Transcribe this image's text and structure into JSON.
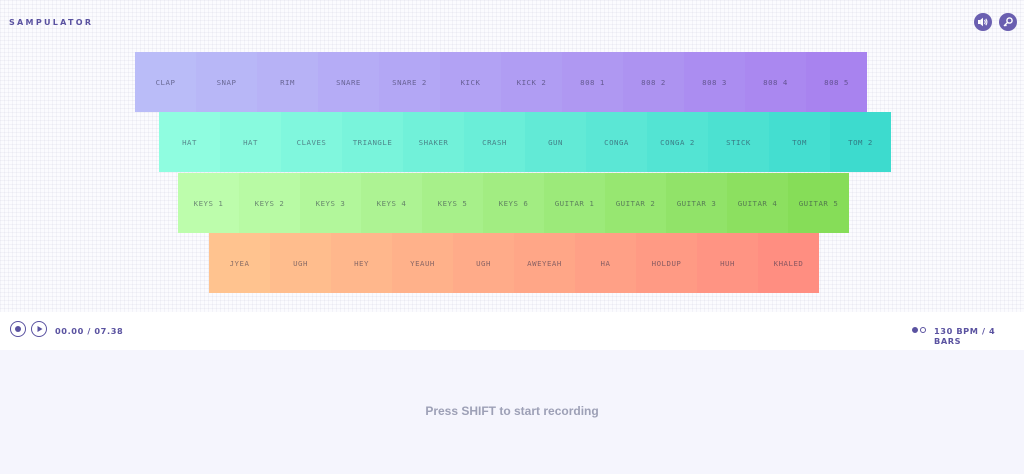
{
  "app": {
    "title": "SAMPULATOR"
  },
  "header": {
    "icons": [
      {
        "name": "sound-icon",
        "color": "#6a5fb0"
      },
      {
        "name": "key-icon",
        "color": "#6a5fb0"
      }
    ]
  },
  "rows": [
    {
      "colors": [
        "#babcf8",
        "#a883ef"
      ],
      "pads": [
        "CLAP",
        "SNAP",
        "RIM",
        "SNARE",
        "SNARE 2",
        "KICK",
        "KICK 2",
        "808 1",
        "808 2",
        "808 3",
        "808 4",
        "808 5"
      ]
    },
    {
      "colors": [
        "#8ffde0",
        "#3ddbce"
      ],
      "pads": [
        "HAT",
        "HAT",
        "CLAVES",
        "TRIANGLE",
        "SHAKER",
        "CRASH",
        "GUN",
        "CONGA",
        "CONGA 2",
        "STICK",
        "TOM",
        "TOM 2"
      ]
    },
    {
      "colors": [
        "#bdfdac",
        "#86dd58"
      ],
      "pads": [
        "KEYS 1",
        "KEYS 2",
        "KEYS 3",
        "KEYS 4",
        "KEYS 5",
        "KEYS 6",
        "GUITAR 1",
        "GUITAR 2",
        "GUITAR 3",
        "GUITAR 4",
        "GUITAR 5"
      ]
    },
    {
      "colors": [
        "#ffc38f",
        "#ff8e81"
      ],
      "pads": [
        "JYEA",
        "UGH",
        "HEY",
        "YEAUH",
        "UGH",
        "AWEYEAH",
        "HA",
        "HOLDUP",
        "HUH",
        "KHALED"
      ]
    }
  ],
  "transport": {
    "time": "00.00 / 07.38",
    "tempo": "130 BPM / 4 BARS",
    "bars_page": {
      "active": 1,
      "total": 2
    },
    "accent": "#5a52a0"
  },
  "recorder": {
    "hint": "Press SHIFT to start recording"
  }
}
